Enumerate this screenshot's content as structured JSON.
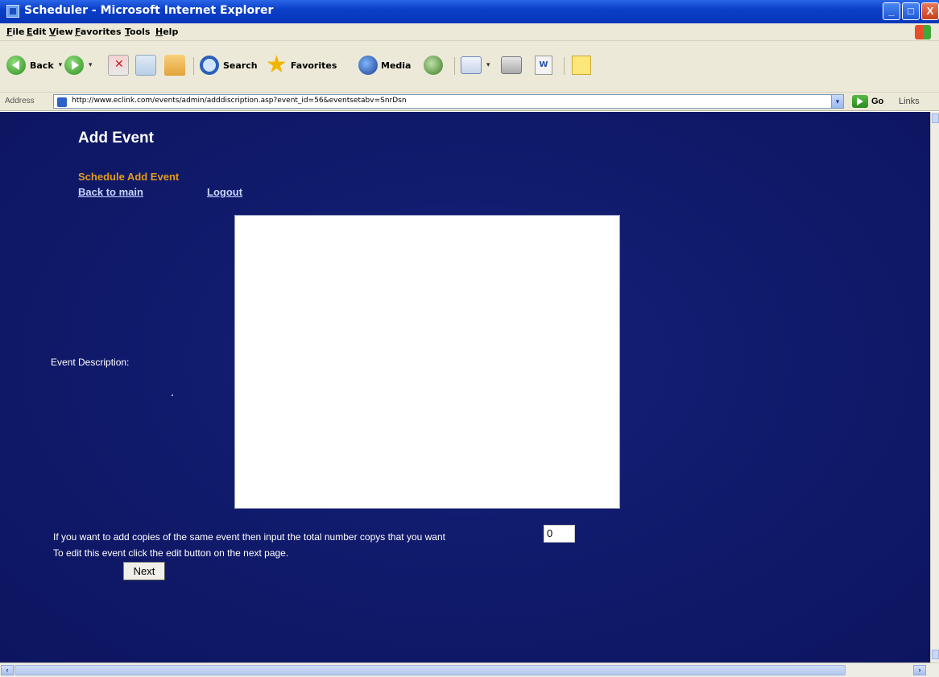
{
  "window": {
    "title": "Scheduler - Microsoft Internet Explorer",
    "min_label": "_",
    "max_label": "□",
    "close_label": "X"
  },
  "menu": [
    "File",
    "Edit",
    "View",
    "Favorites",
    "Tools",
    "Help"
  ],
  "toolbar": {
    "back_label": "Back",
    "search_label": "Search",
    "favorites_label": "Favorites",
    "media_label": "Media",
    "word_label": "W"
  },
  "address": {
    "label": "Address",
    "url": "http://www.eclink.com/events/admin/adddiscription.asp?event_id=56&eventsetabv=SnrDsn",
    "go_label": "Go",
    "links_label": "Links"
  },
  "page": {
    "heading": "Add Event",
    "subtitle": "Schedule Add Event",
    "back_link": "Back to main",
    "logout_link": "Logout",
    "description_label": "Event Description:",
    "description_value": "",
    "copies_text": "If you want to add copies of the same event then input the total number copys that you want",
    "copies_value": "0",
    "edit_text": "To edit this event click the edit button on the next page.",
    "next_label": "Next"
  }
}
